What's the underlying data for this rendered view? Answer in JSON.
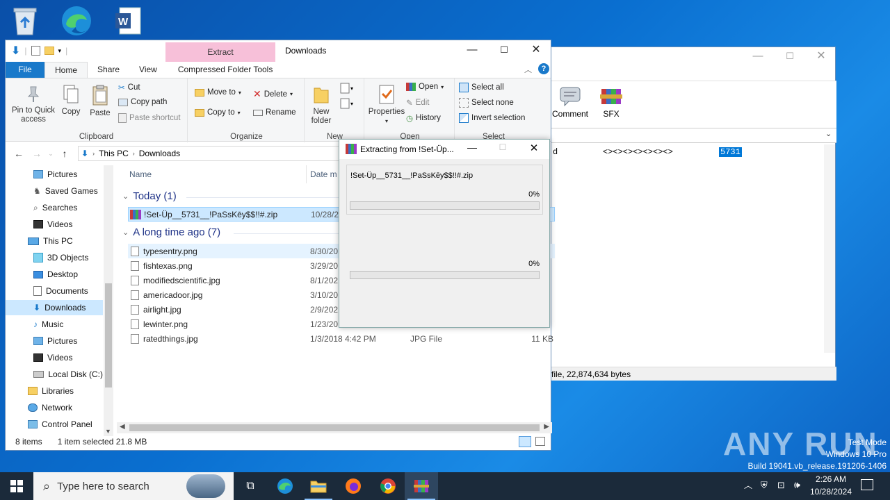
{
  "desktop": {
    "icons": [
      "recycle-bin",
      "microsoft-edge",
      "microsoft-word"
    ]
  },
  "explorer": {
    "window_title": "Downloads",
    "extract_tab": "Extract",
    "ribbon_tabs": [
      "File",
      "Home",
      "Share",
      "View"
    ],
    "contextual_tab": "Compressed Folder Tools",
    "clipboard": {
      "pin": "Pin to Quick access",
      "copy": "Copy",
      "paste": "Paste",
      "cut": "Cut",
      "copy_path": "Copy path",
      "paste_shortcut": "Paste shortcut",
      "label": "Clipboard"
    },
    "organize": {
      "move_to": "Move to",
      "delete": "Delete",
      "copy_to": "Copy to",
      "rename": "Rename",
      "label": "Organize"
    },
    "new": {
      "new_folder": "New folder",
      "label": "New"
    },
    "open": {
      "properties": "Properties",
      "open": "Open",
      "edit": "Edit",
      "history": "History",
      "label": "Open"
    },
    "select": {
      "select_all": "Select all",
      "select_none": "Select none",
      "invert": "Invert selection",
      "label": "Select"
    },
    "address": {
      "this_pc": "This PC",
      "downloads": "Downloads"
    },
    "nav_items": [
      {
        "label": "Pictures",
        "icon": "pictures-icon"
      },
      {
        "label": "Saved Games",
        "icon": "saved-games-icon"
      },
      {
        "label": "Searches",
        "icon": "searches-icon"
      },
      {
        "label": "Videos",
        "icon": "videos-icon"
      },
      {
        "label": "This PC",
        "icon": "this-pc-icon"
      },
      {
        "label": "3D Objects",
        "icon": "3d-objects-icon"
      },
      {
        "label": "Desktop",
        "icon": "desktop-icon"
      },
      {
        "label": "Documents",
        "icon": "documents-icon"
      },
      {
        "label": "Downloads",
        "icon": "downloads-icon",
        "selected": true
      },
      {
        "label": "Music",
        "icon": "music-icon"
      },
      {
        "label": "Pictures",
        "icon": "pictures-icon"
      },
      {
        "label": "Videos",
        "icon": "videos-icon"
      },
      {
        "label": "Local Disk (C:)",
        "icon": "disk-icon"
      },
      {
        "label": "Libraries",
        "icon": "libraries-icon"
      },
      {
        "label": "Network",
        "icon": "network-icon"
      },
      {
        "label": "Control Panel",
        "icon": "control-panel-icon"
      }
    ],
    "columns": {
      "name": "Name",
      "date": "Date m"
    },
    "groups": {
      "today": "Today (1)",
      "long_ago": "A long time ago (7)"
    },
    "files_today": [
      {
        "name": "!Set-Üp__5731__!PaSsKēy$$!!#.zip",
        "date": "10/28/20",
        "type": "",
        "size": ""
      }
    ],
    "files_old": [
      {
        "name": "typesentry.png",
        "date": "8/30/20",
        "type": "",
        "size": ""
      },
      {
        "name": "fishtexas.png",
        "date": "3/29/20",
        "type": "",
        "size": ""
      },
      {
        "name": "modifiedscientific.jpg",
        "date": "8/1/202",
        "type": "",
        "size": ""
      },
      {
        "name": "americadoor.jpg",
        "date": "3/10/20",
        "type": "",
        "size": ""
      },
      {
        "name": "airlight.jpg",
        "date": "2/9/202",
        "type": "",
        "size": ""
      },
      {
        "name": "lewinter.png",
        "date": "1/23/20",
        "type": "",
        "size": ""
      },
      {
        "name": "ratedthings.jpg",
        "date": "1/3/2018 4:42 PM",
        "type": "JPG File",
        "size": "11 KB"
      }
    ],
    "status": {
      "count": "8 items",
      "selection": "1 item selected  21.8 MB"
    }
  },
  "winrar": {
    "tools": [
      "Comment",
      "SFX"
    ],
    "row_name": "d",
    "row_placeholder": "<><><><><><><>",
    "row_highlight": "5731",
    "status": "file, 22,874,634 bytes"
  },
  "dialog": {
    "title": "Extracting from !Set-Üp...",
    "archive": "!Set-Üp__5731__!PaSsKēy$$!!#.zip",
    "progress1": "0%",
    "progress2": "0%"
  },
  "taskbar": {
    "search_placeholder": "Type here to search",
    "time": "2:26 AM",
    "date": "10/28/2024"
  },
  "watermark": {
    "brand": "ANY RUN",
    "mode": "Test Mode",
    "os": "Windows 10 Pro",
    "build": "Build 19041.vb_release.191206-1406"
  }
}
